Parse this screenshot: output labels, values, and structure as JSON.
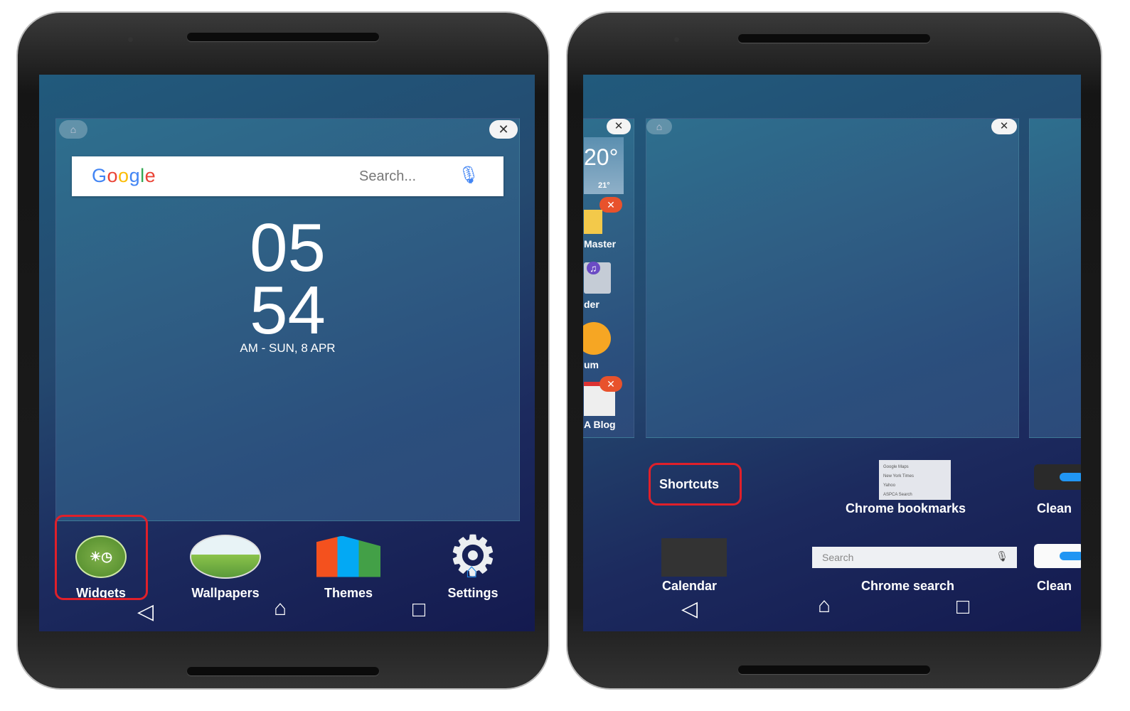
{
  "left_phone": {
    "google_logo": "Google",
    "search_placeholder": "Search...",
    "clock": {
      "hour": "05",
      "minute": "54",
      "date": "AM - SUN, 8 APR"
    },
    "dock": [
      {
        "label": "Widgets",
        "icon": "widgets-icon",
        "highlighted": true
      },
      {
        "label": "Wallpapers",
        "icon": "wallpapers-icon"
      },
      {
        "label": "Themes",
        "icon": "themes-icon"
      },
      {
        "label": "Settings",
        "icon": "settings-icon"
      }
    ],
    "nav": {
      "back": "◁",
      "home": "⌂",
      "recents": "□"
    }
  },
  "right_phone": {
    "side_panel": {
      "weather_temp": "20°",
      "weather_sub": "21°",
      "items": [
        "Master",
        "der",
        "um",
        "A Blog"
      ]
    },
    "widgets": [
      {
        "label": "Shortcuts",
        "highlighted": true
      },
      {
        "label": "Chrome bookmarks",
        "bookmarks": [
          "Google Maps",
          "New York Times",
          "Yahoo",
          "ASPCA Search"
        ]
      },
      {
        "label": "Clean"
      },
      {
        "label": "Calendar"
      },
      {
        "label": "Chrome search",
        "search_placeholder": "Search"
      },
      {
        "label": "Clean"
      }
    ],
    "nav": {
      "back": "◁",
      "home": "⌂",
      "recents": "□"
    }
  },
  "colors": {
    "highlight": "#e0202a",
    "screen_bg": "#1c2a5e"
  }
}
